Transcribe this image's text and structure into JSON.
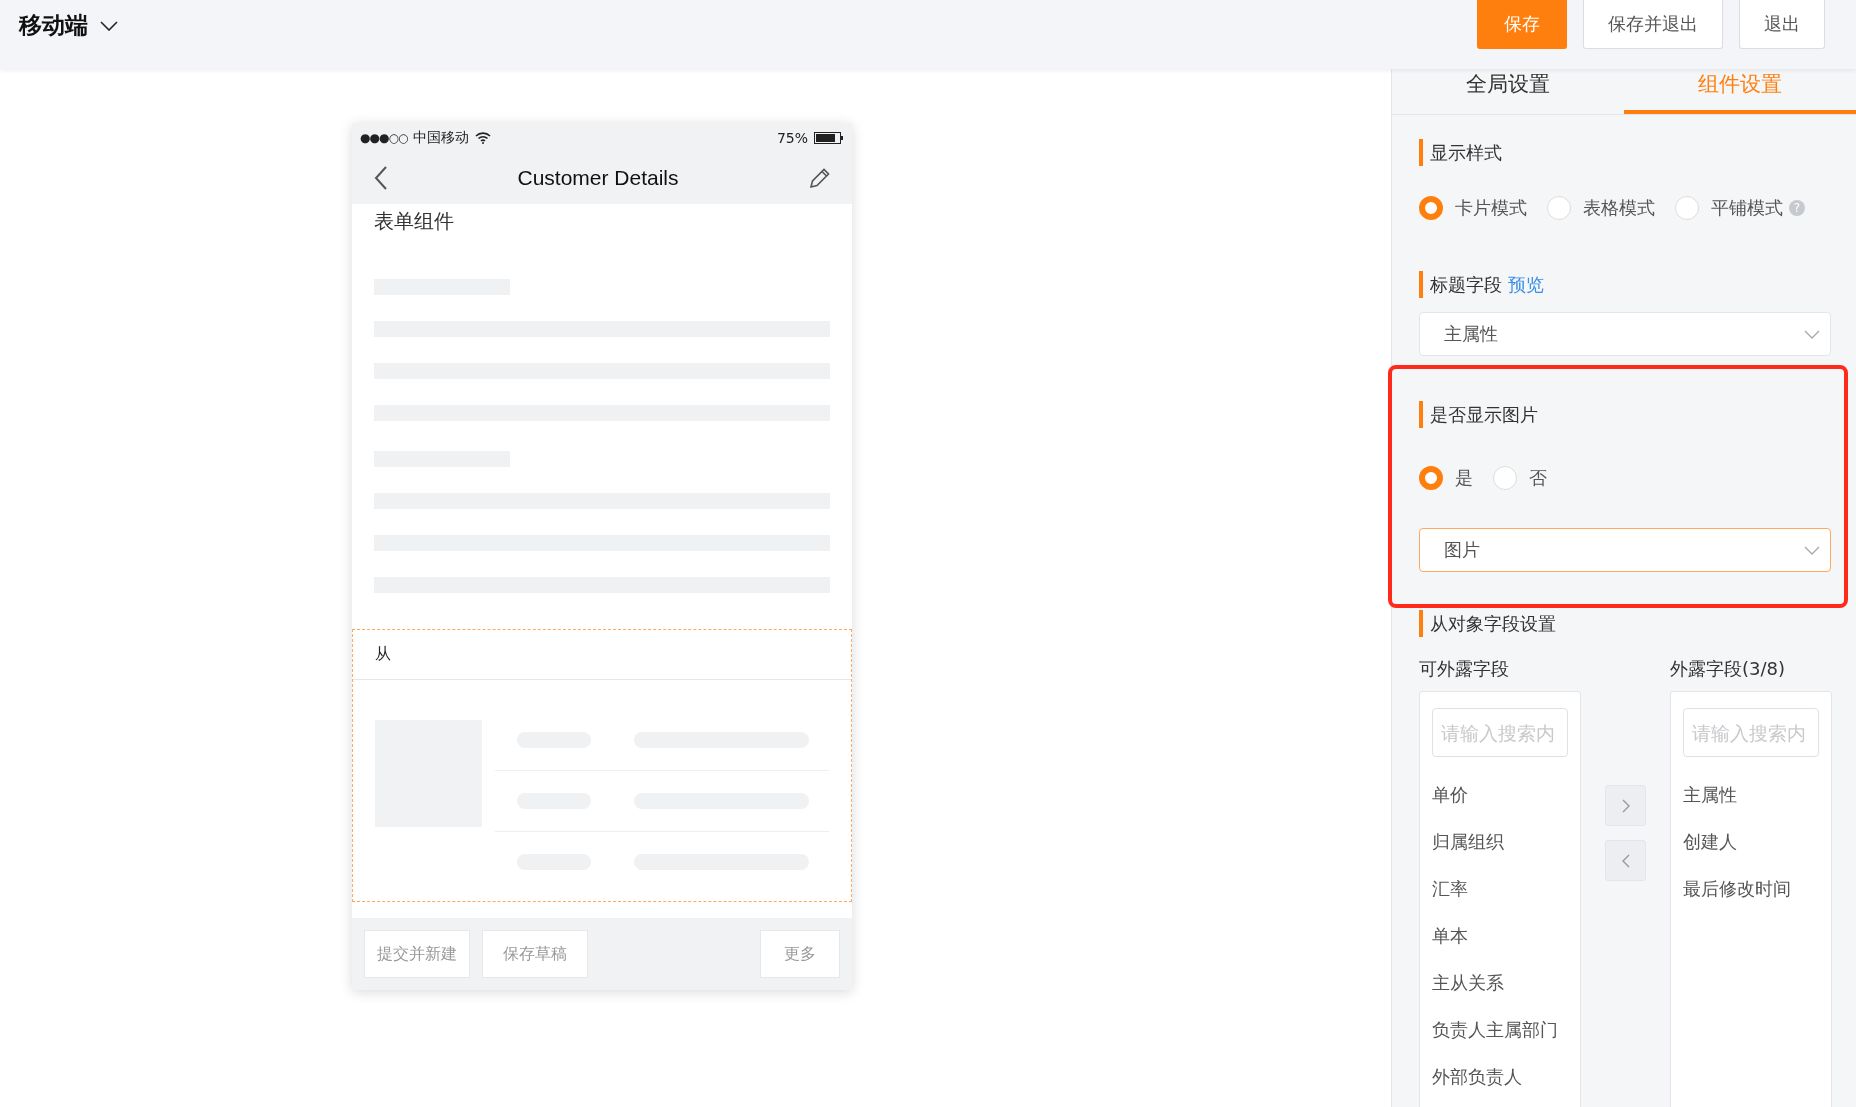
{
  "header": {
    "title": "移动端",
    "buttons": [
      {
        "label": "保存",
        "kind": "primary"
      },
      {
        "label": "保存并退出",
        "kind": "default"
      },
      {
        "label": "退出",
        "kind": "default"
      }
    ]
  },
  "phone": {
    "status_bar": {
      "signal": "●●●○○",
      "carrier": "中国移动",
      "battery": "75%"
    },
    "nav_title": "Customer Details",
    "form_title": "表单组件",
    "sub_title": "从",
    "footer_buttons": [
      "提交并新建",
      "保存草稿"
    ],
    "more_button": "更多"
  },
  "tabs": [
    {
      "label": "全局设置",
      "selected": false
    },
    {
      "label": "组件设置",
      "selected": true
    }
  ],
  "display_style": {
    "heading": "显示样式",
    "options": [
      {
        "label": "卡片模式",
        "selected": true
      },
      {
        "label": "表格模式",
        "selected": false
      },
      {
        "label": "平铺模式",
        "selected": false
      }
    ],
    "hint": "?"
  },
  "title_field": {
    "heading": "标题字段",
    "link": "预览",
    "value": "主属性"
  },
  "show_image": {
    "heading": "是否显示图片",
    "highlighted": true,
    "options": [
      {
        "label": "是",
        "selected": true
      },
      {
        "label": "否",
        "selected": false
      }
    ],
    "value": "图片"
  },
  "sub_fields": {
    "heading": "从对象字段设置",
    "available": {
      "label": "可外露字段",
      "placeholder": "请输入搜索内",
      "items": [
        "单价",
        "归属组织",
        "汇率",
        "单本",
        "主从关系",
        "负责人主属部门",
        "外部负责人"
      ]
    },
    "shown": {
      "label": "外露字段(3/8)",
      "placeholder": "请输入搜索内",
      "items": [
        "主属性",
        "创建人",
        "最后修改时间"
      ]
    }
  }
}
